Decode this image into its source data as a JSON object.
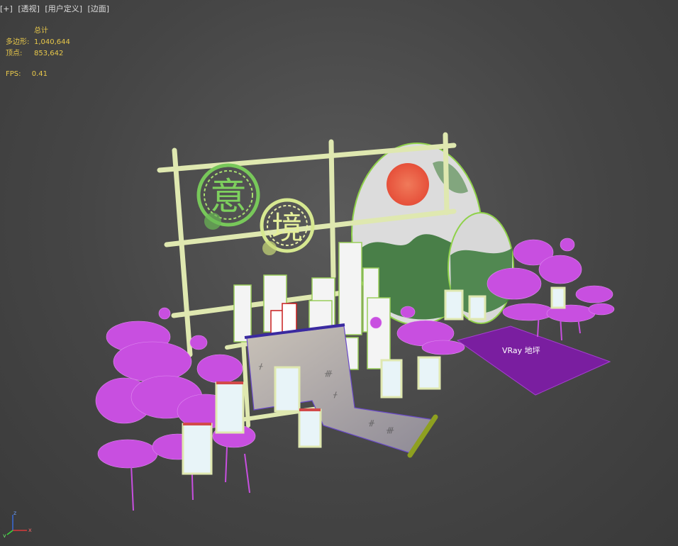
{
  "viewport": {
    "labels": [
      "[+]",
      "[透视]",
      "[用户定义]",
      "[边面]"
    ]
  },
  "stats": {
    "total_label": "总计",
    "polygons_label": "多边形:",
    "polygons_value": "1,040,644",
    "vertices_label": "顶点:",
    "vertices_value": "853,642",
    "fps_label": "FPS:",
    "fps_value": "0.41"
  },
  "scene": {
    "object_label": "VRay 地坪",
    "sign_chars": [
      "意",
      "境"
    ]
  },
  "axis": {
    "z": "z",
    "x": "x",
    "y": "y"
  },
  "colors": {
    "background": "#454545",
    "stats_text": "#e8c84a",
    "wireframe_lotus": "#c84fe0",
    "frame": "#dfe8b0",
    "floor_plane": "#7a1ea0"
  }
}
